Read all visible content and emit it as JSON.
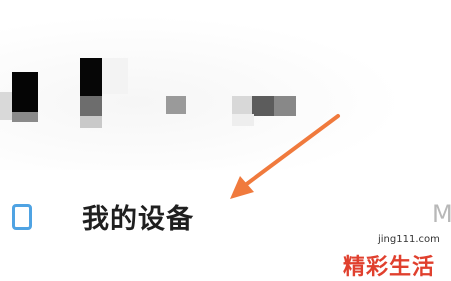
{
  "settings_row": {
    "label": "我的设备",
    "trailing_text": "M",
    "icon": "device-icon",
    "icon_color": "#4fa3e3"
  },
  "annotation": {
    "arrow_color": "#f07a3d"
  },
  "watermark": {
    "site": "jing111.com",
    "brand": "精彩生活",
    "brand_color": "#e0402e"
  },
  "header": {
    "obscured": true
  }
}
